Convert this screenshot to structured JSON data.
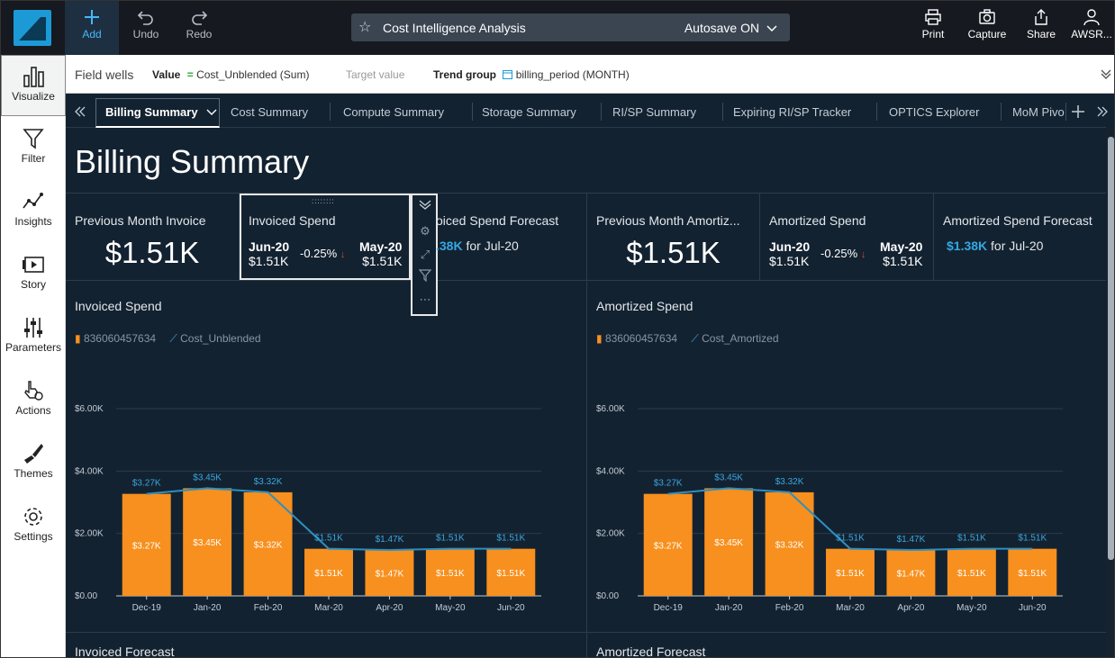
{
  "toolbar": {
    "add": "Add",
    "undo": "Undo",
    "redo": "Redo",
    "analysis_title": "Cost Intelligence Analysis",
    "autosave": "Autosave ON",
    "print": "Print",
    "capture": "Capture",
    "share": "Share",
    "user": "AWSR..."
  },
  "field_wells": {
    "label": "Field wells",
    "value_label": "Value",
    "value_field": "Cost_Unblended (Sum)",
    "target_label": "Target value",
    "trend_label": "Trend group",
    "trend_field": "billing_period (MONTH)"
  },
  "sidebar": {
    "items": [
      {
        "label": "Visualize",
        "icon": "bar-chart-icon"
      },
      {
        "label": "Filter",
        "icon": "filter-icon"
      },
      {
        "label": "Insights",
        "icon": "insights-icon"
      },
      {
        "label": "Story",
        "icon": "story-icon"
      },
      {
        "label": "Parameters",
        "icon": "sliders-icon"
      },
      {
        "label": "Actions",
        "icon": "pointer-gear-icon"
      },
      {
        "label": "Themes",
        "icon": "brush-icon"
      },
      {
        "label": "Settings",
        "icon": "gear-icon"
      }
    ]
  },
  "tabs": [
    "Billing Summary",
    "Cost Summary",
    "Compute Summary",
    "Storage Summary",
    "RI/SP Summary",
    "Expiring RI/SP Tracker",
    "OPTICS Explorer",
    "MoM Pivo"
  ],
  "page_title": "Billing Summary",
  "kpis": {
    "prev_invoice": {
      "title": "Previous Month Invoice",
      "value": "$1.51K"
    },
    "invoiced_spend": {
      "title": "Invoiced Spend",
      "cur_period": "Jun-20",
      "cur_value": "$1.51K",
      "change": "-0.25%",
      "prev_period": "May-20",
      "prev_value": "$1.51K"
    },
    "invoiced_forecast": {
      "title": "oiced Spend Forecast",
      "value": ".38K",
      "suffix": "for Jul-20"
    },
    "prev_amortized": {
      "title": "Previous Month Amortiz...",
      "value": "$1.51K"
    },
    "amortized_spend": {
      "title": "Amortized Spend",
      "cur_period": "Jun-20",
      "cur_value": "$1.51K",
      "change": "-0.25%",
      "prev_period": "May-20",
      "prev_value": "$1.51K"
    },
    "amortized_forecast": {
      "title": "Amortized Spend Forecast",
      "value": "$1.38K",
      "suffix": "for Jul-20"
    }
  },
  "colors": {
    "bar": "#f7901e",
    "line": "#2f8fc0",
    "accent": "#34a8e3",
    "down": "#e0452b"
  },
  "chart_data": [
    {
      "type": "bar",
      "title": "Invoiced Spend",
      "categories": [
        "Dec-19",
        "Jan-20",
        "Feb-20",
        "Mar-20",
        "Apr-20",
        "May-20",
        "Jun-20"
      ],
      "series": [
        {
          "name": "836060457634",
          "type": "bar",
          "values": [
            3.27,
            3.45,
            3.32,
            1.51,
            1.47,
            1.51,
            1.51
          ],
          "labels": [
            "$3.27K",
            "$3.45K",
            "$3.32K",
            "$1.51K",
            "$1.47K",
            "$1.51K",
            "$1.51K"
          ]
        },
        {
          "name": "Cost_Unblended",
          "type": "line",
          "values": [
            3.27,
            3.45,
            3.32,
            1.51,
            1.47,
            1.51,
            1.51
          ],
          "labels": [
            "$3.27K",
            "$3.45K",
            "$3.32K",
            "$1.51K",
            "$1.47K",
            "$1.51K",
            "$1.51K"
          ]
        }
      ],
      "yticks": [
        "$0.00",
        "$2.00K",
        "$4.00K",
        "$6.00K"
      ],
      "ylim": [
        0,
        6
      ]
    },
    {
      "type": "bar",
      "title": "Amortized Spend",
      "categories": [
        "Dec-19",
        "Jan-20",
        "Feb-20",
        "Mar-20",
        "Apr-20",
        "May-20",
        "Jun-20"
      ],
      "series": [
        {
          "name": "836060457634",
          "type": "bar",
          "values": [
            3.27,
            3.45,
            3.32,
            1.51,
            1.47,
            1.51,
            1.51
          ],
          "labels": [
            "$3.27K",
            "$3.45K",
            "$3.32K",
            "$1.51K",
            "$1.47K",
            "$1.51K",
            "$1.51K"
          ]
        },
        {
          "name": "Cost_Amortized",
          "type": "line",
          "values": [
            3.27,
            3.45,
            3.32,
            1.51,
            1.47,
            1.51,
            1.51
          ],
          "labels": [
            "$3.27K",
            "$3.45K",
            "$3.32K",
            "$1.51K",
            "$1.47K",
            "$1.51K",
            "$1.51K"
          ]
        }
      ],
      "yticks": [
        "$0.00",
        "$2.00K",
        "$4.00K",
        "$6.00K"
      ],
      "ylim": [
        0,
        6
      ]
    }
  ],
  "bottom": {
    "left": "Invoiced Forecast",
    "right": "Amortized Forecast"
  }
}
